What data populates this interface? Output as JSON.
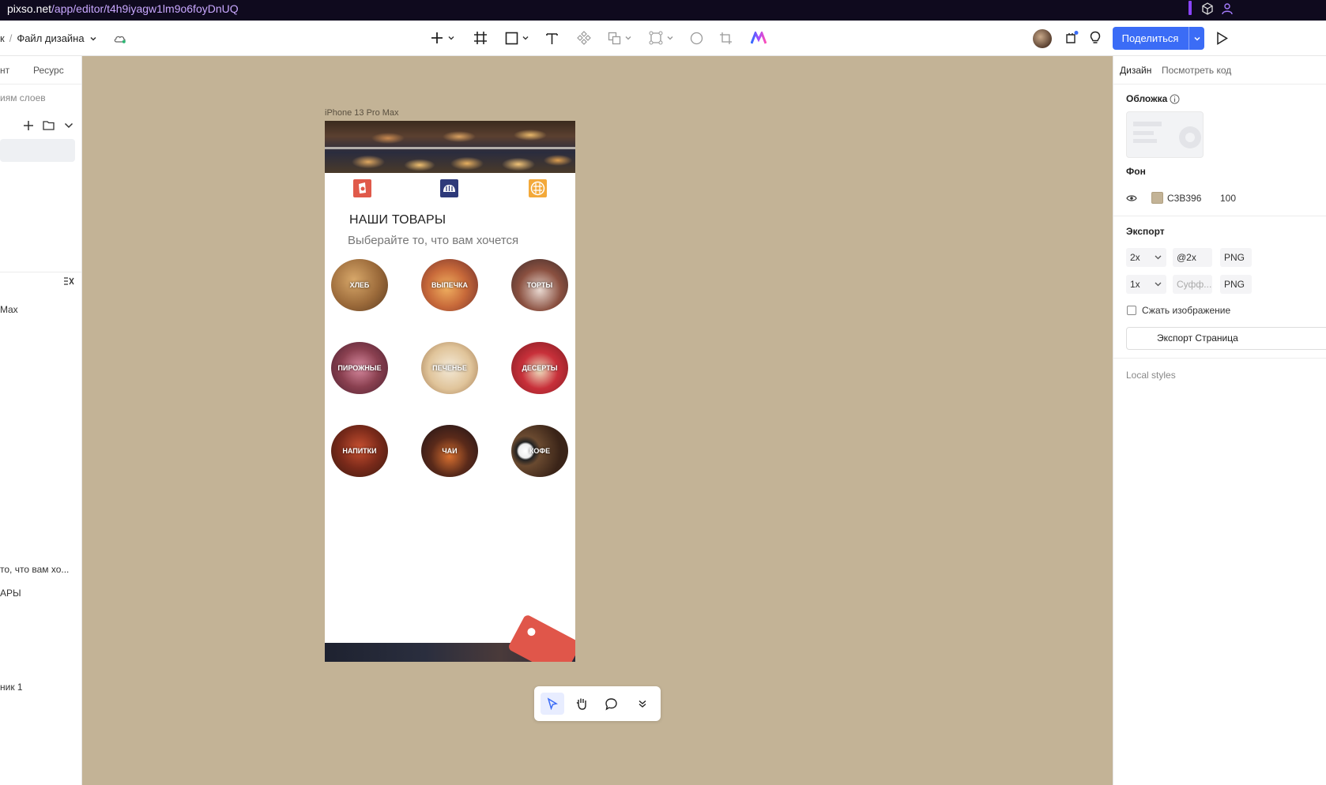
{
  "browser": {
    "url_host": "pixso.net",
    "url_path": "/app/editor/t4h9iyagw1lm9o6foyDnUQ"
  },
  "toolbar": {
    "breadcrumb_prefix": "к",
    "breadcrumb_sep": "/",
    "file_name": "Файл дизайна",
    "share_label": "Поделиться"
  },
  "left_panel": {
    "tab_1": "нт",
    "tab_2": "Ресурс",
    "search_placeholder": "иям слоев",
    "layers": [
      "Max",
      "то, что вам хо...",
      "АРЫ",
      "ник 1"
    ]
  },
  "canvas": {
    "background": "#c3b396",
    "frame_label": "iPhone 13 Pro Max",
    "heading": "НАШИ ТОВАРЫ",
    "subheading": "Выберайте то, что вам хочется",
    "categories": [
      "ХЛЕБ",
      "ВЫПЕЧКА",
      "ТОРТЫ",
      "ПИРОЖНЫЕ",
      "ПЕЧЕНЬЕ",
      "ДЕСЕРТЫ",
      "НАПИТКИ",
      "ЧАИ",
      "КОФЕ"
    ],
    "top_icons": [
      "cake-icon",
      "bread-icon",
      "waffle-icon"
    ]
  },
  "right_panel": {
    "tab_design": "Дизайн",
    "tab_code": "Посмотреть код",
    "cover_label": "Обложка",
    "bg_label": "Фон",
    "bg_hex": "C3B396",
    "bg_opacity": "100",
    "export_label": "Экспорт",
    "export_rows": [
      {
        "scale": "2x",
        "suffix": "@2x",
        "format": "PNG"
      },
      {
        "scale": "1x",
        "suffix": "Суфф...",
        "format": "PNG"
      }
    ],
    "compress_label": "Сжать изображение",
    "export_button": "Экспорт Страница",
    "local_styles": "Local styles"
  }
}
